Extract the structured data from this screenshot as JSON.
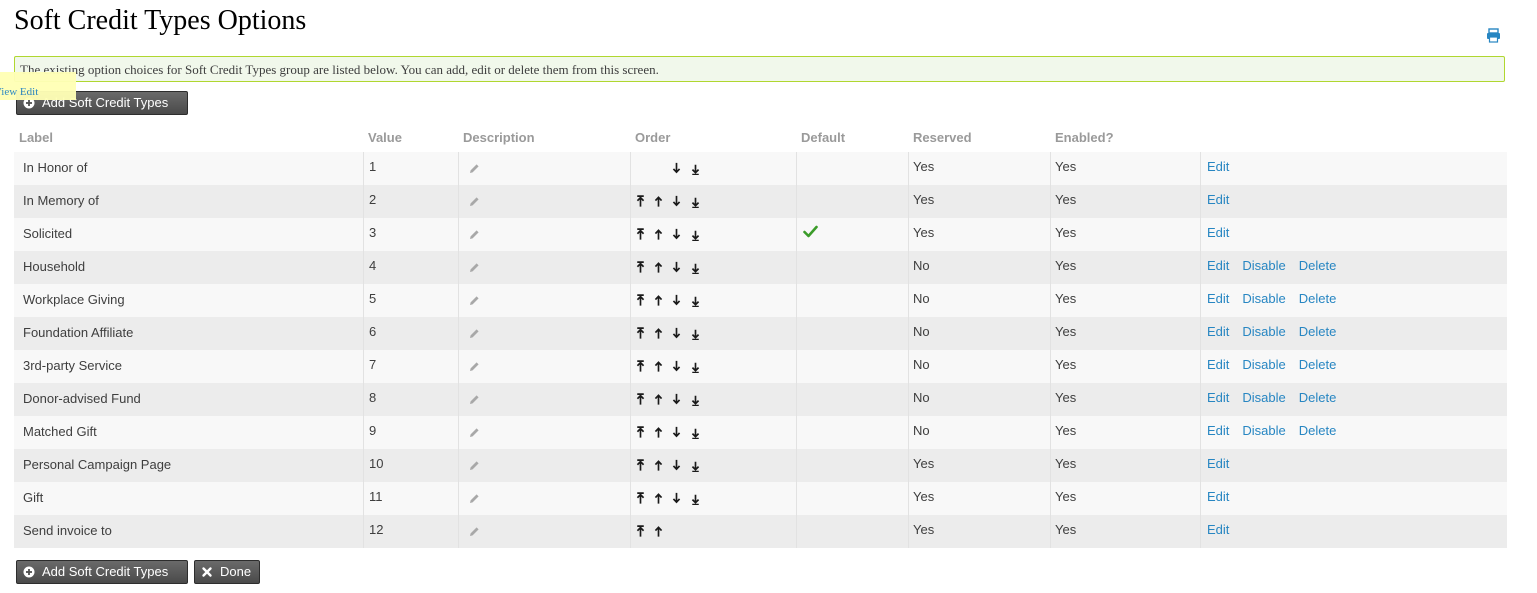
{
  "page": {
    "title": "Soft Credit Types Options",
    "help_text": "The existing option choices for Soft Credit Types group are listed below. You can add, edit or delete them from this screen.",
    "tooltip_text": "View Edit"
  },
  "buttons": {
    "add_label": "Add Soft Credit Types",
    "done_label": "Done"
  },
  "icons": {
    "print": "print-icon",
    "plus": "plus-circle-icon",
    "close": "close-icon",
    "pencil": "pencil-icon",
    "check": "checkmark-icon",
    "order": [
      "move-to-top-icon",
      "move-up-icon",
      "move-down-icon",
      "move-to-bottom-icon"
    ]
  },
  "colors": {
    "link": "#2786c2",
    "button": "#505050",
    "check": "#3b9c2a",
    "help_bg": "#f1f8eb",
    "help_border": "#b0d730"
  },
  "table": {
    "headers": {
      "label": "Label",
      "value": "Value",
      "description": "Description",
      "order": "Order",
      "default": "Default",
      "reserved": "Reserved",
      "enabled": "Enabled?"
    },
    "link_labels": {
      "edit": "Edit",
      "disable": "Disable",
      "delete": "Delete"
    },
    "rows": [
      {
        "label": "In Honor of",
        "value": "1",
        "default": false,
        "reserved": "Yes",
        "enabled": "Yes",
        "order": [
          false,
          false,
          true,
          true
        ],
        "actions": [
          "edit"
        ]
      },
      {
        "label": "In Memory of",
        "value": "2",
        "default": false,
        "reserved": "Yes",
        "enabled": "Yes",
        "order": [
          true,
          true,
          true,
          true
        ],
        "actions": [
          "edit"
        ]
      },
      {
        "label": "Solicited",
        "value": "3",
        "default": true,
        "reserved": "Yes",
        "enabled": "Yes",
        "order": [
          true,
          true,
          true,
          true
        ],
        "actions": [
          "edit"
        ]
      },
      {
        "label": "Household",
        "value": "4",
        "default": false,
        "reserved": "No",
        "enabled": "Yes",
        "order": [
          true,
          true,
          true,
          true
        ],
        "actions": [
          "edit",
          "disable",
          "delete"
        ]
      },
      {
        "label": "Workplace Giving",
        "value": "5",
        "default": false,
        "reserved": "No",
        "enabled": "Yes",
        "order": [
          true,
          true,
          true,
          true
        ],
        "actions": [
          "edit",
          "disable",
          "delete"
        ]
      },
      {
        "label": "Foundation Affiliate",
        "value": "6",
        "default": false,
        "reserved": "No",
        "enabled": "Yes",
        "order": [
          true,
          true,
          true,
          true
        ],
        "actions": [
          "edit",
          "disable",
          "delete"
        ]
      },
      {
        "label": "3rd-party Service",
        "value": "7",
        "default": false,
        "reserved": "No",
        "enabled": "Yes",
        "order": [
          true,
          true,
          true,
          true
        ],
        "actions": [
          "edit",
          "disable",
          "delete"
        ]
      },
      {
        "label": "Donor-advised Fund",
        "value": "8",
        "default": false,
        "reserved": "No",
        "enabled": "Yes",
        "order": [
          true,
          true,
          true,
          true
        ],
        "actions": [
          "edit",
          "disable",
          "delete"
        ]
      },
      {
        "label": "Matched Gift",
        "value": "9",
        "default": false,
        "reserved": "No",
        "enabled": "Yes",
        "order": [
          true,
          true,
          true,
          true
        ],
        "actions": [
          "edit",
          "disable",
          "delete"
        ]
      },
      {
        "label": "Personal Campaign Page",
        "value": "10",
        "default": false,
        "reserved": "Yes",
        "enabled": "Yes",
        "order": [
          true,
          true,
          true,
          true
        ],
        "actions": [
          "edit"
        ]
      },
      {
        "label": "Gift",
        "value": "11",
        "default": false,
        "reserved": "Yes",
        "enabled": "Yes",
        "order": [
          true,
          true,
          true,
          true
        ],
        "actions": [
          "edit"
        ]
      },
      {
        "label": "Send invoice to",
        "value": "12",
        "default": false,
        "reserved": "Yes",
        "enabled": "Yes",
        "order": [
          true,
          true,
          false,
          false
        ],
        "actions": [
          "edit"
        ]
      }
    ]
  }
}
